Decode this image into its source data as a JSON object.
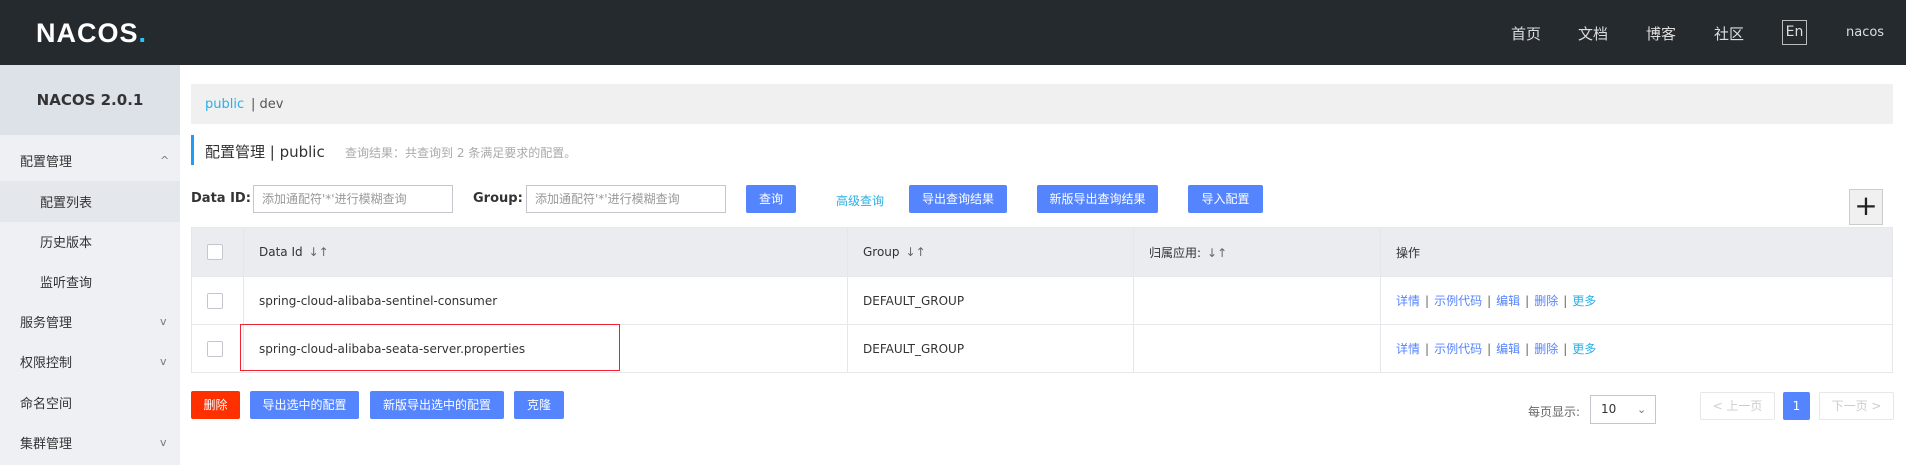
{
  "header": {
    "logo_text": "NACOS",
    "logo_dot": ".",
    "nav": [
      "首页",
      "文档",
      "博客",
      "社区"
    ],
    "lang": "En",
    "user": "nacos"
  },
  "sidebar": {
    "version": "NACOS 2.0.1",
    "items": [
      {
        "label": "配置管理",
        "chevron": "^"
      },
      {
        "label": "配置列表"
      },
      {
        "label": "历史版本"
      },
      {
        "label": "监听查询"
      },
      {
        "label": "服务管理",
        "chevron": "v"
      },
      {
        "label": "权限控制",
        "chevron": "v"
      },
      {
        "label": "命名空间"
      },
      {
        "label": "集群管理",
        "chevron": "v"
      }
    ]
  },
  "namespace": {
    "public": "public",
    "dev": "| dev"
  },
  "title": {
    "text": "配置管理  |  public",
    "result": "查询结果：共查询到 2 条满足要求的配置。"
  },
  "filters": {
    "dataid_label": "Data ID:",
    "dataid_placeholder": "添加通配符'*'进行模糊查询",
    "group_label": "Group:",
    "group_placeholder": "添加通配符'*'进行模糊查询",
    "query": "查询",
    "advanced": "高级查询",
    "export": "导出查询结果",
    "new_export": "新版导出查询结果",
    "import": "导入配置",
    "plus": "+"
  },
  "table": {
    "headers": [
      "Data Id",
      "Group",
      "归属应用:",
      "操作"
    ],
    "sort_icon": "↓↑",
    "rows": [
      {
        "dataid": "spring-cloud-alibaba-sentinel-consumer",
        "group": "DEFAULT_GROUP",
        "app": ""
      },
      {
        "dataid": "spring-cloud-alibaba-seata-server.properties",
        "group": "DEFAULT_GROUP",
        "app": ""
      }
    ],
    "ops": [
      "详情",
      "示例代码",
      "编辑",
      "删除",
      "更多"
    ]
  },
  "bottom": {
    "delete": "删除",
    "export_selected": "导出选中的配置",
    "new_export_selected": "新版导出选中的配置",
    "clone": "克隆"
  },
  "pagination": {
    "page_size_label": "每页显示:",
    "page_size": "10",
    "prev": "< 上一页",
    "current": "1",
    "next": "下一页 >"
  }
}
